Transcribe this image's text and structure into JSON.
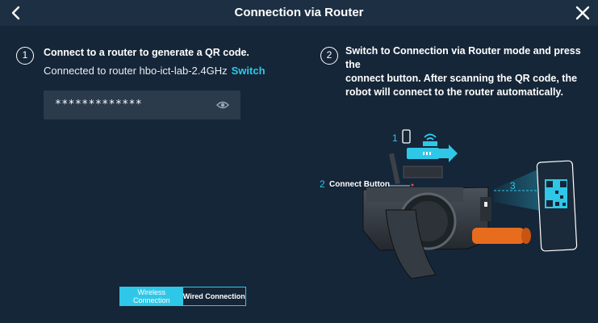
{
  "header": {
    "title": "Connection via Router"
  },
  "step1": {
    "number": "1",
    "title": "Connect to a router to generate a QR code.",
    "router_text": "Connected to router hbo-ict-lab-2.4GHz",
    "switch_label": "Switch",
    "password_value": "*************"
  },
  "step2": {
    "number": "2",
    "title_line1": "Switch to Connection via Router mode and press the",
    "title_line2": "connect button. After scanning the QR code, the",
    "title_line3": "robot will connect to the router automatically."
  },
  "illustration": {
    "label1_num": "1",
    "label2_num": "2",
    "label2_text": "Connect Button",
    "label3_num": "3"
  },
  "toggle": {
    "wireless_line1": "Wireless",
    "wireless_line2": "Connection",
    "wired_label": "Wired Connection",
    "selected": "Wireless Connection"
  },
  "colors": {
    "background": "#152638",
    "header": "#1d2f42",
    "accent": "#2fc7e8",
    "input": "#2b3b4c"
  },
  "icons": [
    "back-icon",
    "close-icon",
    "eye-icon",
    "wifi-icon",
    "phone-icon"
  ]
}
